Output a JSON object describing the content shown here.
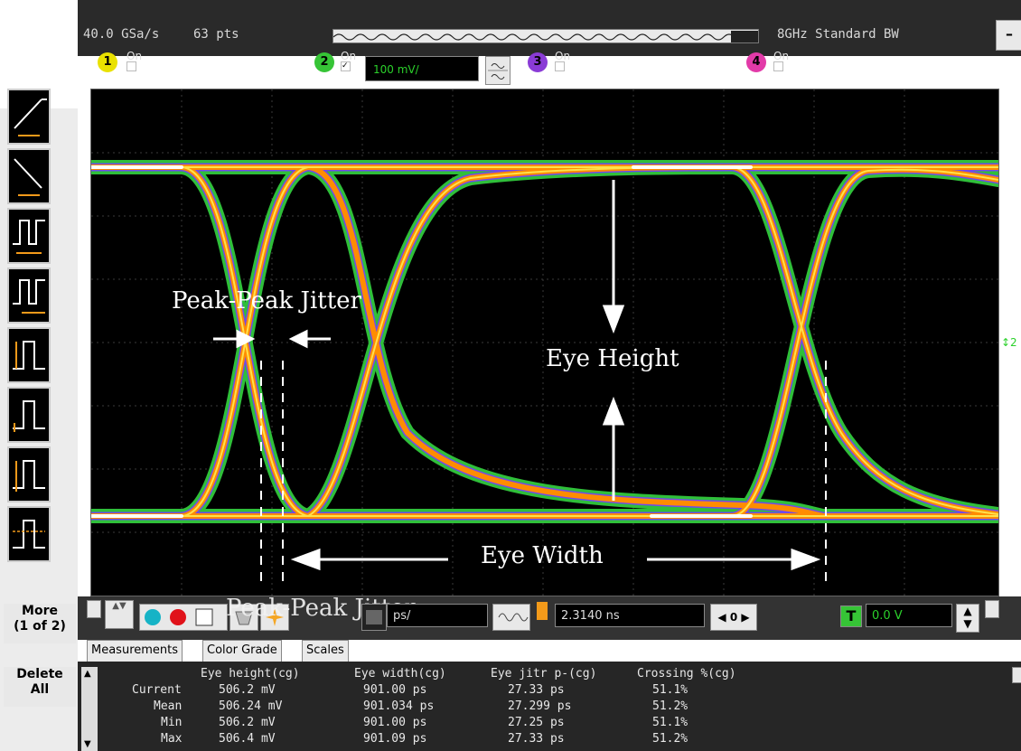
{
  "top": {
    "sample_rate": "40.0 GSa/s",
    "points": "63 pts",
    "bandwidth": "8GHz Standard BW"
  },
  "channels": [
    {
      "num": "1",
      "on_label": "On",
      "checked": false,
      "color": "#e9e100"
    },
    {
      "num": "2",
      "on_label": "On",
      "checked": true,
      "color": "#36c436"
    },
    {
      "num": "3",
      "on_label": "On",
      "checked": false,
      "color": "#8a3bd6"
    },
    {
      "num": "4",
      "on_label": "On",
      "checked": false,
      "color": "#e23aa8"
    }
  ],
  "ch2_scale": "100 mV/",
  "left_buttons": {
    "more": "More\n(1 of 2)",
    "delete": "Delete\nAll"
  },
  "annotations": {
    "jitter": "Peak-Peak Jitter",
    "eye_height": "Eye Height",
    "eye_width": "Eye Width",
    "jitter_echo": "Peak-Peak Jitter"
  },
  "bottom": {
    "timebase": "ps/",
    "delay": "2.3140 ns",
    "offset_value": "0",
    "trigger_level": "0.0 V"
  },
  "tabs": [
    "Measurements",
    "Color Grade",
    "Scales"
  ],
  "measurements": {
    "headers": [
      "Eye height(cg)",
      "Eye width(cg)",
      "Eye jitr p-(cg)",
      "Crossing %(cg)"
    ],
    "rows": [
      {
        "label": "Current",
        "values": [
          "506.2 mV",
          "901.00 ps",
          "27.33 ps",
          "51.1%"
        ]
      },
      {
        "label": "Mean",
        "values": [
          "506.24 mV",
          "901.034 ps",
          "27.299 ps",
          "51.2%"
        ]
      },
      {
        "label": "Min",
        "values": [
          "506.2 mV",
          "901.00 ps",
          "27.25 ps",
          "51.1%"
        ]
      },
      {
        "label": "Max",
        "values": [
          "506.4 mV",
          "901.09 ps",
          "27.33 ps",
          "51.2%"
        ]
      }
    ]
  },
  "colors": {
    "trace_green": "#2fbf3a",
    "trace_orange": "#ff8c00",
    "trace_yellow": "#ffe14a",
    "trace_purple": "#7a3cff",
    "screen_bg": "#000000"
  }
}
